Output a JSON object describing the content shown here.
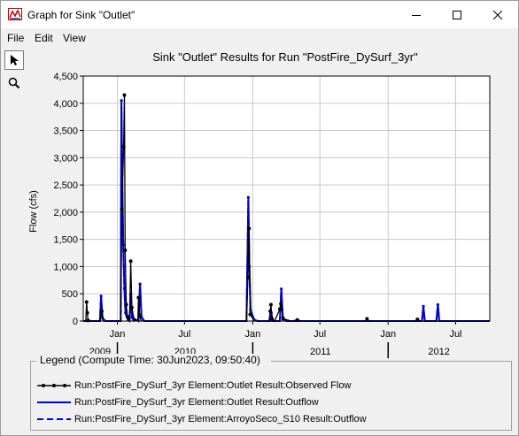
{
  "window": {
    "title": "Graph for Sink \"Outlet\"",
    "minimize_glyph": "—",
    "maximize_glyph": "☐",
    "close_glyph": "✕"
  },
  "menu": [
    "File",
    "Edit",
    "View"
  ],
  "toolbar": {
    "tools": [
      "select-arrow-icon",
      "zoom-magnifier-icon"
    ]
  },
  "colors": {
    "observed": "#000000",
    "outflow": "#0000cc",
    "grid": "#c8c8c8",
    "background": "#ffffff"
  },
  "chart_data": {
    "type": "line",
    "title": "Sink \"Outlet\" Results for Run \"PostFire_DySurf_3yr\"",
    "ylabel": "Flow (cfs)",
    "ylim": [
      0,
      4500
    ],
    "yticks": [
      "0",
      "500",
      "1,000",
      "1,500",
      "2,000",
      "2,500",
      "3,000",
      "3,500",
      "4,000",
      "4,500"
    ],
    "xticks": [
      "Jan",
      "Jul",
      "Jan",
      "Jul",
      "Jan",
      "Jul"
    ],
    "xtick_dates": [
      "2010-01-01",
      "2010-07-01",
      "2011-01-01",
      "2011-07-01",
      "2012-01-01",
      "2012-07-01"
    ],
    "years": [
      "2009",
      "2010",
      "2011",
      "2012"
    ],
    "xlim": [
      "2009-10-01",
      "2012-10-01"
    ],
    "grid": true,
    "legend_placement": "bottom",
    "series": [
      {
        "name": "Run:PostFire_DySurf_3yr Element:Outlet Result:Observed Flow",
        "style": "solid-marker",
        "color": "#000000",
        "points": [
          [
            "2009-10-01",
            0
          ],
          [
            "2009-10-08",
            0
          ],
          [
            "2009-10-10",
            350
          ],
          [
            "2009-10-12",
            150
          ],
          [
            "2009-10-14",
            10
          ],
          [
            "2009-11-15",
            0
          ],
          [
            "2009-11-20",
            180
          ],
          [
            "2009-11-24",
            0
          ],
          [
            "2010-01-10",
            0
          ],
          [
            "2010-01-13",
            2050
          ],
          [
            "2010-01-18",
            3200
          ],
          [
            "2010-01-20",
            4150
          ],
          [
            "2010-01-22",
            1300
          ],
          [
            "2010-01-25",
            300
          ],
          [
            "2010-01-28",
            80
          ],
          [
            "2010-02-03",
            0
          ],
          [
            "2010-02-06",
            1100
          ],
          [
            "2010-02-09",
            250
          ],
          [
            "2010-02-15",
            20
          ],
          [
            "2010-02-25",
            0
          ],
          [
            "2010-02-27",
            430
          ],
          [
            "2010-03-02",
            100
          ],
          [
            "2010-03-06",
            0
          ],
          [
            "2010-12-15",
            0
          ],
          [
            "2010-12-19",
            800
          ],
          [
            "2010-12-22",
            1700
          ],
          [
            "2010-12-25",
            120
          ],
          [
            "2011-01-05",
            0
          ],
          [
            "2011-02-14",
            0
          ],
          [
            "2011-02-17",
            180
          ],
          [
            "2011-02-19",
            300
          ],
          [
            "2011-02-22",
            40
          ],
          [
            "2011-03-01",
            0
          ],
          [
            "2011-03-15",
            220
          ],
          [
            "2011-03-18",
            320
          ],
          [
            "2011-03-24",
            40
          ],
          [
            "2011-04-15",
            0
          ],
          [
            "2011-05-01",
            20
          ],
          [
            "2011-05-15",
            0
          ],
          [
            "2011-11-01",
            0
          ],
          [
            "2011-11-05",
            40
          ],
          [
            "2011-11-10",
            0
          ],
          [
            "2012-03-15",
            0
          ],
          [
            "2012-03-20",
            30
          ],
          [
            "2012-03-26",
            0
          ],
          [
            "2012-10-01",
            0
          ]
        ]
      },
      {
        "name": "Run:PostFire_DySurf_3yr Element:Outlet Result:Outflow",
        "style": "solid",
        "color": "#0000cc",
        "points": [
          [
            "2009-10-01",
            0
          ],
          [
            "2009-11-15",
            0
          ],
          [
            "2009-11-18",
            460
          ],
          [
            "2009-11-22",
            50
          ],
          [
            "2009-11-30",
            0
          ],
          [
            "2010-01-10",
            0
          ],
          [
            "2010-01-12",
            4050
          ],
          [
            "2010-01-14",
            2700
          ],
          [
            "2010-01-17",
            1400
          ],
          [
            "2010-01-20",
            600
          ],
          [
            "2010-01-23",
            150
          ],
          [
            "2010-01-30",
            20
          ],
          [
            "2010-02-03",
            0
          ],
          [
            "2010-02-06",
            500
          ],
          [
            "2010-02-10",
            60
          ],
          [
            "2010-02-27",
            0
          ],
          [
            "2010-03-03",
            680
          ],
          [
            "2010-03-07",
            70
          ],
          [
            "2010-03-15",
            0
          ],
          [
            "2010-12-15",
            0
          ],
          [
            "2010-12-20",
            2270
          ],
          [
            "2010-12-23",
            1000
          ],
          [
            "2010-12-26",
            200
          ],
          [
            "2011-01-05",
            20
          ],
          [
            "2011-01-15",
            0
          ],
          [
            "2011-02-17",
            0
          ],
          [
            "2011-02-20",
            150
          ],
          [
            "2011-02-24",
            0
          ],
          [
            "2011-03-15",
            0
          ],
          [
            "2011-03-19",
            590
          ],
          [
            "2011-03-23",
            70
          ],
          [
            "2011-04-01",
            0
          ],
          [
            "2012-04-01",
            0
          ],
          [
            "2012-04-05",
            270
          ],
          [
            "2012-04-09",
            0
          ],
          [
            "2012-05-10",
            0
          ],
          [
            "2012-05-14",
            300
          ],
          [
            "2012-05-18",
            0
          ],
          [
            "2012-10-01",
            0
          ]
        ]
      },
      {
        "name": "Run:PostFire_DySurf_3yr Element:ArroyoSeco_S10 Result:Outflow",
        "style": "dashed",
        "color": "#0000cc",
        "points": [
          [
            "2009-10-01",
            0
          ],
          [
            "2009-11-15",
            0
          ],
          [
            "2009-11-18",
            440
          ],
          [
            "2009-11-22",
            40
          ],
          [
            "2009-11-30",
            0
          ],
          [
            "2010-01-10",
            0
          ],
          [
            "2010-01-12",
            3950
          ],
          [
            "2010-01-14",
            2600
          ],
          [
            "2010-01-17",
            1350
          ],
          [
            "2010-01-20",
            560
          ],
          [
            "2010-01-23",
            140
          ],
          [
            "2010-01-30",
            15
          ],
          [
            "2010-02-03",
            0
          ],
          [
            "2010-02-06",
            480
          ],
          [
            "2010-02-10",
            50
          ],
          [
            "2010-02-27",
            0
          ],
          [
            "2010-03-03",
            660
          ],
          [
            "2010-03-07",
            60
          ],
          [
            "2010-03-15",
            0
          ],
          [
            "2010-12-15",
            0
          ],
          [
            "2010-12-20",
            2220
          ],
          [
            "2010-12-23",
            960
          ],
          [
            "2010-12-26",
            180
          ],
          [
            "2011-01-05",
            15
          ],
          [
            "2011-01-15",
            0
          ],
          [
            "2011-03-15",
            0
          ],
          [
            "2011-03-19",
            570
          ],
          [
            "2011-03-23",
            60
          ],
          [
            "2011-04-01",
            0
          ],
          [
            "2012-04-01",
            0
          ],
          [
            "2012-04-05",
            260
          ],
          [
            "2012-04-09",
            0
          ],
          [
            "2012-05-10",
            0
          ],
          [
            "2012-05-14",
            290
          ],
          [
            "2012-05-18",
            0
          ],
          [
            "2012-10-01",
            0
          ]
        ]
      }
    ]
  },
  "legend": {
    "title": "Legend (Compute Time: 30Jun2023, 09:50:40)",
    "items": [
      "Run:PostFire_DySurf_3yr Element:Outlet Result:Observed Flow",
      "Run:PostFire_DySurf_3yr Element:Outlet Result:Outflow",
      "Run:PostFire_DySurf_3yr Element:ArroyoSeco_S10 Result:Outflow"
    ]
  }
}
